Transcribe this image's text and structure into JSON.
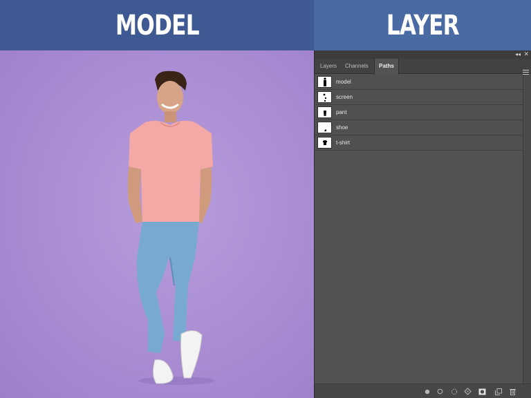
{
  "headers": {
    "left": "MODEL",
    "right": "LAYER"
  },
  "panel": {
    "tabs": [
      "Layers",
      "Channels",
      "Paths"
    ],
    "active_tab": "Paths",
    "collapse_glyph": "◂◂",
    "close_glyph": "✕",
    "paths": [
      {
        "name": "model",
        "thumb_icon": "person-silhouette-icon"
      },
      {
        "name": "screen",
        "thumb_icon": "sparse-shapes-icon"
      },
      {
        "name": "pant",
        "thumb_icon": "pants-shape-icon"
      },
      {
        "name": "shoe",
        "thumb_icon": "shoe-shape-icon"
      },
      {
        "name": "t-shirt",
        "thumb_icon": "tshirt-shape-icon"
      }
    ],
    "bottom_tools": [
      "fill-path-icon",
      "stroke-path-icon",
      "load-selection-icon",
      "make-work-path-icon",
      "add-mask-icon",
      "new-path-icon",
      "trash-icon"
    ]
  },
  "colors": {
    "header_left": "#3f5a92",
    "header_right": "#4a6aa3",
    "background": "#a98cd2",
    "panel": "#535353"
  }
}
